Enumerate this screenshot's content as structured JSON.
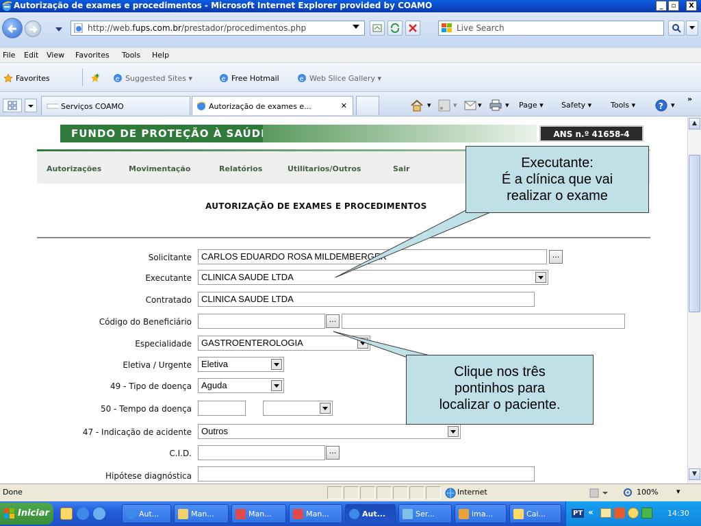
{
  "window": {
    "title": "Autorização de exames e procedimentos - Microsoft Internet Explorer provided by COAMO",
    "btn_min": "_",
    "btn_max": "▫",
    "btn_close": "X"
  },
  "addressbar": {
    "url_prefix": "http://web.",
    "url_domain": "fups.com.br",
    "url_path": "/prestador/procedimentos.php",
    "search_placeholder": "Live Search"
  },
  "menu": [
    "File",
    "Edit",
    "View",
    "Favorites",
    "Tools",
    "Help"
  ],
  "favorites_bar": {
    "favorites": "Favorites",
    "suggested_sites": "Suggested Sites ▾",
    "free_hotmail": "Free Hotmail",
    "web_slice_gallery": "Web Slice Gallery ▾"
  },
  "tabs": [
    {
      "label": "Serviços COAMO"
    },
    {
      "label": "Autorização de exames e...",
      "close": "✕"
    }
  ],
  "commands": {
    "page": "Page ▾",
    "safety": "Safety ▾",
    "tools": "Tools ▾",
    "more": "»"
  },
  "page": {
    "banner": "FUNDO DE PROTEÇÃO À SAÚDE",
    "ans": "ANS n.º 41658-4",
    "nav": [
      "Autorizações",
      "Movimentação",
      "Relatórios",
      "Utilitarios/Outros",
      "Sair"
    ],
    "heading": "AUTORIZAÇÃO DE EXAMES E PROCEDIMENTOS",
    "form": {
      "solicitante_label": "Solicitante",
      "solicitante_value": "CARLOS EDUARDO ROSA MILDEMBERGER",
      "executante_label": "Executante",
      "executante_value": "CLINICA SAUDE LTDA",
      "contratado_label": "Contratado",
      "contratado_value": "CLINICA SAUDE LTDA",
      "beneficiario_label": "Código do Beneficiário",
      "beneficiario_value": "",
      "especialidade_label": "Especialidade",
      "especialidade_value": "GASTROENTEROLOGIA",
      "eletiva_label": "Eletiva / Urgente",
      "eletiva_value": "Eletiva",
      "tipo_doenca_label": "49 - Tipo de doença",
      "tipo_doenca_value": "Aguda",
      "tempo_doenca_label": "50 - Tempo da doença",
      "tempo_doenca_value": "",
      "tempo_unidade_value": "",
      "acidente_label": "47 - Indicação de acidente",
      "acidente_value": "Outros",
      "cid_label": "C.I.D.",
      "cid_value": "",
      "hipotese_label": "Hipótese diagnóstica",
      "hipotese_value": "",
      "dots": "..."
    }
  },
  "callouts": {
    "executante": {
      "line1": "Executante:",
      "line2": "É a clínica que vai",
      "line3": "realizar o exame"
    },
    "paciente": {
      "line1": "Clique nos três",
      "line2": "pontinhos para",
      "line3": "localizar o paciente."
    }
  },
  "status": {
    "text": "Done",
    "zone": "Internet",
    "zoom": "100%"
  },
  "taskbar": {
    "start": "Iniciar",
    "items": [
      "Aut...",
      "Man...",
      "Man...",
      "Man...",
      "Aut...",
      "Ser...",
      "ima...",
      "Cai..."
    ],
    "lang": "PT",
    "clock": "14:30"
  },
  "colors": {
    "banner_green": "#2f7a3a",
    "callout_fill": "#bfe0e6",
    "xp_blue": "#245edb"
  }
}
